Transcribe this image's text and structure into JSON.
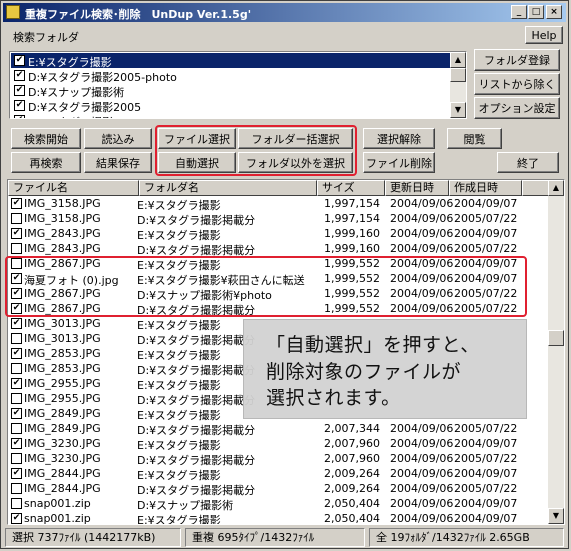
{
  "window": {
    "title": "重複ファイル検索･削除　UnDup Ver.1.5g'"
  },
  "caption_buttons": {
    "minimize": "_",
    "maximize": "□",
    "close": "×"
  },
  "help_label": "Help",
  "folders_section": {
    "label": "検索フォルダ",
    "items": [
      {
        "path": "E:¥スタグラ撮影",
        "checked": true,
        "selected": true
      },
      {
        "path": "D:¥スタグラ撮影2005-photo",
        "checked": true,
        "selected": false
      },
      {
        "path": "D:¥スナップ撮影術",
        "checked": true,
        "selected": false
      },
      {
        "path": "D:¥スタグラ撮影2005",
        "checked": true,
        "selected": false
      },
      {
        "path": "D:¥スタグラ撮影2005-info",
        "checked": true,
        "selected": false
      }
    ],
    "side_buttons": {
      "register": "フォルダ登録",
      "remove": "リストから除く",
      "options": "オプション設定"
    }
  },
  "toolbar": {
    "search_start": "検索開始",
    "load": "読込み",
    "file_select": "ファイル選択",
    "folder_bulk_select": "フォルダー括選択",
    "deselect": "選択解除",
    "view": "閲覧",
    "research": "再検索",
    "save_results": "結果保存",
    "auto_select": "自動選択",
    "select_except_folder": "フォルダ以外を選択",
    "delete_files": "ファイル削除",
    "exit": "終了"
  },
  "table": {
    "columns": {
      "name": "ファイル名",
      "folder": "フォルダ名",
      "size": "サイズ",
      "modified": "更新日時",
      "created": "作成日時"
    },
    "rows": [
      {
        "checked": true,
        "name": "IMG_3158.JPG",
        "folder": "E:¥スタグラ撮影",
        "size": "1,997,154",
        "modified": "2004/09/06",
        "created": "2004/09/07"
      },
      {
        "checked": false,
        "name": "IMG_3158.JPG",
        "folder": "D:¥スタグラ撮影掲載分",
        "size": "1,997,154",
        "modified": "2004/09/06",
        "created": "2005/07/22"
      },
      {
        "checked": true,
        "name": "IMG_2843.JPG",
        "folder": "E:¥スタグラ撮影",
        "size": "1,999,160",
        "modified": "2004/09/06",
        "created": "2004/09/07"
      },
      {
        "checked": false,
        "name": "IMG_2843.JPG",
        "folder": "D:¥スタグラ撮影掲載分",
        "size": "1,999,160",
        "modified": "2004/09/06",
        "created": "2005/07/22"
      },
      {
        "checked": false,
        "name": "IMG_2867.JPG",
        "folder": "E:¥スタグラ撮影",
        "size": "1,999,552",
        "modified": "2004/09/06",
        "created": "2004/09/07"
      },
      {
        "checked": true,
        "name": "海夏フォト (0).jpg",
        "folder": "E:¥スタグラ撮影¥萩田さんに転送",
        "size": "1,999,552",
        "modified": "2004/09/06",
        "created": "2004/09/07"
      },
      {
        "checked": true,
        "name": "IMG_2867.JPG",
        "folder": "D:¥スナップ撮影術¥photo",
        "size": "1,999,552",
        "modified": "2004/09/06",
        "created": "2005/07/22"
      },
      {
        "checked": true,
        "name": "IMG_2867.JPG",
        "folder": "D:¥スタグラ撮影掲載分",
        "size": "1,999,552",
        "modified": "2004/09/06",
        "created": "2005/07/22"
      },
      {
        "checked": true,
        "name": "IMG_3013.JPG",
        "folder": "E:¥スタグラ撮影",
        "size": "",
        "modified": "",
        "created": ""
      },
      {
        "checked": false,
        "name": "IMG_3013.JPG",
        "folder": "D:¥スタグラ撮影掲載分",
        "size": "",
        "modified": "",
        "created": ""
      },
      {
        "checked": true,
        "name": "IMG_2853.JPG",
        "folder": "E:¥スタグラ撮影",
        "size": "",
        "modified": "",
        "created": ""
      },
      {
        "checked": false,
        "name": "IMG_2853.JPG",
        "folder": "D:¥スタグラ撮影掲載分",
        "size": "",
        "modified": "",
        "created": ""
      },
      {
        "checked": true,
        "name": "IMG_2955.JPG",
        "folder": "E:¥スタグラ撮影",
        "size": "",
        "modified": "",
        "created": ""
      },
      {
        "checked": false,
        "name": "IMG_2955.JPG",
        "folder": "D:¥スタグラ撮影掲載分",
        "size": "",
        "modified": "",
        "created": ""
      },
      {
        "checked": true,
        "name": "IMG_2849.JPG",
        "folder": "E:¥スタグラ撮影",
        "size": "",
        "modified": "",
        "created": ""
      },
      {
        "checked": false,
        "name": "IMG_2849.JPG",
        "folder": "D:¥スタグラ撮影掲載分",
        "size": "2,007,344",
        "modified": "2004/09/06",
        "created": "2005/07/22"
      },
      {
        "checked": true,
        "name": "IMG_3230.JPG",
        "folder": "E:¥スタグラ撮影",
        "size": "2,007,960",
        "modified": "2004/09/06",
        "created": "2004/09/07"
      },
      {
        "checked": false,
        "name": "IMG_3230.JPG",
        "folder": "D:¥スタグラ撮影掲載分",
        "size": "2,007,960",
        "modified": "2004/09/06",
        "created": "2005/07/22"
      },
      {
        "checked": true,
        "name": "IMG_2844.JPG",
        "folder": "E:¥スタグラ撮影",
        "size": "2,009,264",
        "modified": "2004/09/06",
        "created": "2004/09/07"
      },
      {
        "checked": false,
        "name": "IMG_2844.JPG",
        "folder": "D:¥スタグラ撮影掲載分",
        "size": "2,009,264",
        "modified": "2004/09/06",
        "created": "2005/07/22"
      },
      {
        "checked": false,
        "name": "snap001.zip",
        "folder": "D:¥スナップ撮影術",
        "size": "2,050,404",
        "modified": "2004/09/06",
        "created": "2004/09/07"
      },
      {
        "checked": true,
        "name": "snap001.zip",
        "folder": "E:¥スタグラ撮影",
        "size": "2,050,404",
        "modified": "2004/09/06",
        "created": "2004/09/07"
      }
    ]
  },
  "status_bar": {
    "selected": "選択 737ﾌｧｲﾙ (1442177kB)",
    "duplicates": "重複 695ﾀｲﾌﾟ/1432ﾌｧｲﾙ",
    "total": "全 19ﾌｫﾙﾀﾞ/1432ﾌｧｲﾙ 2.65GB"
  },
  "callout": {
    "lines": [
      "「自動選択」を押すと、",
      "削除対象のファイルが",
      "選択されます。"
    ]
  },
  "colors": {
    "selection": "#0a246a",
    "highlight": "#e02030"
  }
}
